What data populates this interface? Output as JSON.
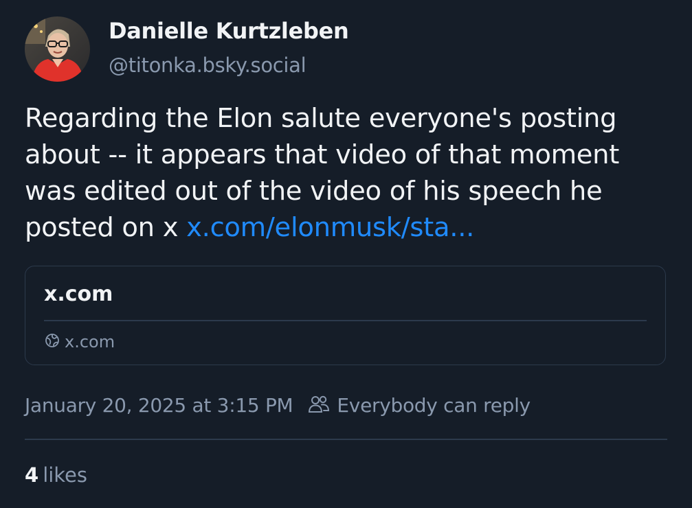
{
  "author": {
    "display_name": "Danielle Kurtzleben",
    "handle": "@titonka.bsky.social"
  },
  "post": {
    "text_lines": [
      "Regarding the Elon salute everyone's posting",
      "about -- it appears that video of that moment",
      "was edited out of the video of his speech he",
      "posted on x "
    ],
    "link_text": "x.com/elonmusk/sta...",
    "link_color": "#208bfe"
  },
  "embed": {
    "title": "x.com",
    "domain": "x.com",
    "icon": "globe-icon"
  },
  "meta": {
    "timestamp": "January 20, 2025 at 3:15 PM",
    "reply_setting": "Everybody can reply",
    "reply_icon": "people-icon"
  },
  "stats": {
    "likes_count": "4",
    "likes_label": "likes"
  },
  "colors": {
    "background": "#151d28",
    "text_primary": "#f1f3f5",
    "text_secondary": "#8a99ae",
    "border": "#2c3a4c",
    "link": "#208bfe"
  }
}
